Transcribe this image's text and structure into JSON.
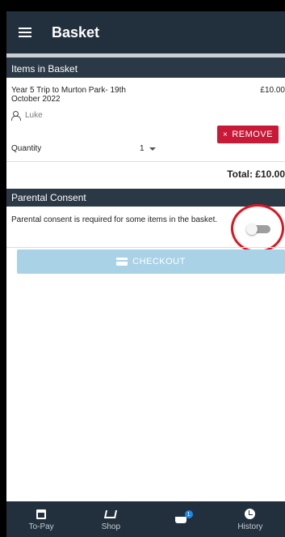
{
  "app": {
    "title": "Basket"
  },
  "items_section": {
    "header": "Items in Basket",
    "item": {
      "name": "Year 5 Trip to Murton Park- 19th October 2022",
      "price": "£10.00",
      "person": "Luke",
      "remove_label": "REMOVE",
      "remove_icon": "×",
      "quantity_label": "Quantity",
      "quantity_value": "1"
    },
    "total": "Total: £10.00"
  },
  "consent_section": {
    "header": "Parental Consent",
    "text": "Parental consent is required for some items in the basket.",
    "toggle_on": false
  },
  "checkout": {
    "label": "CHECKOUT",
    "enabled": false
  },
  "bottom_nav": [
    {
      "label": "To-Pay",
      "icon": "calendar-icon"
    },
    {
      "label": "Shop",
      "icon": "cart-icon"
    },
    {
      "label": "",
      "icon": "basket-icon",
      "badge": "1"
    },
    {
      "label": "History",
      "icon": "clock-icon"
    }
  ],
  "colors": {
    "appbar": "#22303d",
    "section_header": "#2b3946",
    "remove": "#c81937",
    "checkout_disabled": "#a9d2e6",
    "annotation": "#e0141e"
  }
}
